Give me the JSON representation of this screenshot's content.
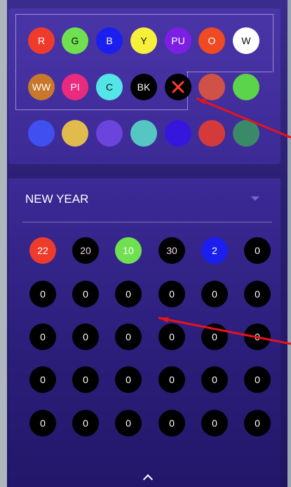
{
  "palette": {
    "row1": [
      {
        "label": "R",
        "color": "#ee3b2c"
      },
      {
        "label": "G",
        "color": "#6fe04f"
      },
      {
        "label": "B",
        "color": "#1a1ff0"
      },
      {
        "label": "Y",
        "color": "#f6f03a"
      },
      {
        "label": "PU",
        "color": "#7d1fe2"
      },
      {
        "label": "O",
        "color": "#ef4a22"
      },
      {
        "label": "W",
        "color": "#ffffff"
      }
    ],
    "row2": [
      {
        "label": "WW",
        "color": "#c8782b"
      },
      {
        "label": "PI",
        "color": "#ea2a7e"
      },
      {
        "label": "C",
        "color": "#54e6e6"
      },
      {
        "label": "BK",
        "color": "#000000"
      },
      {
        "label": "",
        "color": "#000000",
        "icon": "close-icon",
        "icon_color": "#ff3b30"
      },
      {
        "label": "",
        "color": "#cf5147"
      },
      {
        "label": "",
        "color": "#5bd34b"
      }
    ],
    "row3": [
      {
        "label": "",
        "color": "#3f4ff0"
      },
      {
        "label": "",
        "color": "#e1bc4d"
      },
      {
        "label": "",
        "color": "#6a44dc"
      },
      {
        "label": "",
        "color": "#55c6c2"
      },
      {
        "label": "",
        "color": "#3516dc"
      },
      {
        "label": "",
        "color": "#d43a3a"
      },
      {
        "label": "",
        "color": "#3a8a6a"
      }
    ]
  },
  "preset": {
    "name": "NEW YEAR",
    "grid": [
      [
        {
          "value": "22",
          "color": "#ee3b2c"
        },
        {
          "value": "20",
          "color": "#000000"
        },
        {
          "value": "10",
          "color": "#6fe04f"
        },
        {
          "value": "30",
          "color": "#000000"
        },
        {
          "value": "2",
          "color": "#1a1ff0"
        },
        {
          "value": "0",
          "color": "#000000"
        }
      ],
      [
        {
          "value": "0"
        },
        {
          "value": "0"
        },
        {
          "value": "0"
        },
        {
          "value": "0"
        },
        {
          "value": "0"
        },
        {
          "value": "0"
        }
      ],
      [
        {
          "value": "0"
        },
        {
          "value": "0"
        },
        {
          "value": "0"
        },
        {
          "value": "0"
        },
        {
          "value": "0"
        },
        {
          "value": "0"
        }
      ],
      [
        {
          "value": "0"
        },
        {
          "value": "0"
        },
        {
          "value": "0"
        },
        {
          "value": "0"
        },
        {
          "value": "0"
        },
        {
          "value": "0"
        }
      ],
      [
        {
          "value": "0"
        },
        {
          "value": "0"
        },
        {
          "value": "0"
        },
        {
          "value": "0"
        },
        {
          "value": "0"
        },
        {
          "value": "0"
        }
      ]
    ]
  },
  "annotation_color": "#e8121b"
}
